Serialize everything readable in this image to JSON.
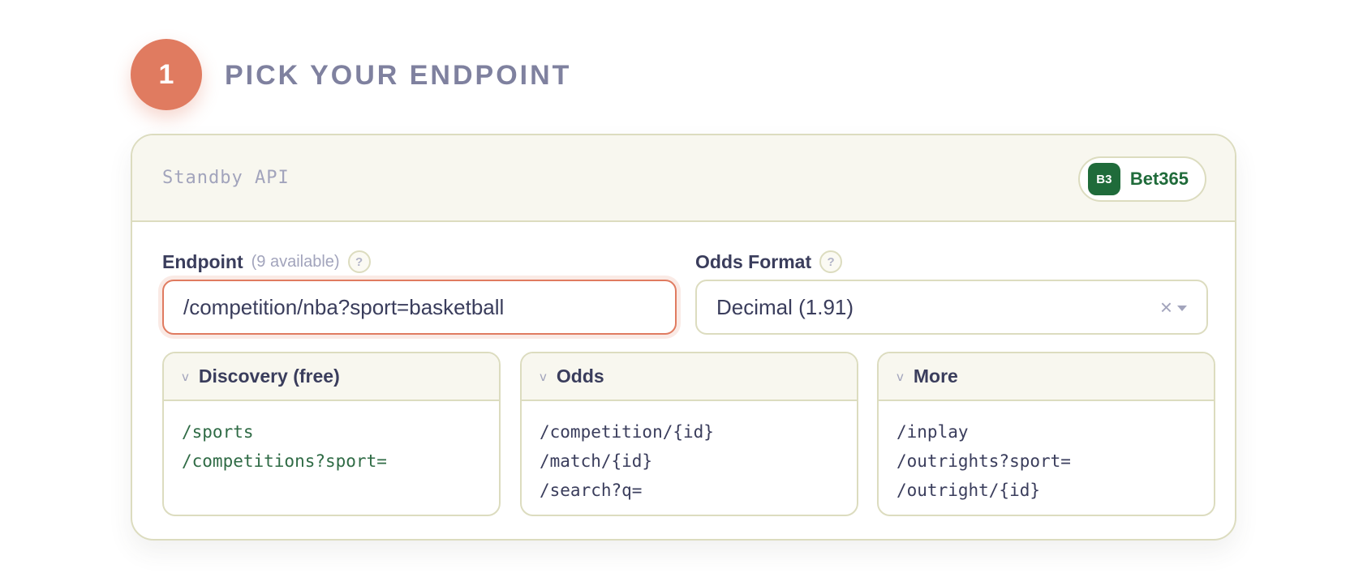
{
  "step": {
    "number": "1",
    "title": "PICK YOUR ENDPOINT"
  },
  "card": {
    "header_title": "Standby API",
    "provider": {
      "logo_text": "B3",
      "name": "Bet365",
      "color": "#1f6b3a"
    }
  },
  "endpoint": {
    "label": "Endpoint",
    "hint": "(9 available)",
    "help": "?",
    "value": "/competition/nba?sport=basketball"
  },
  "odds_format": {
    "label": "Odds Format",
    "help": "?",
    "value": "Decimal (1.91)",
    "clear": "×"
  },
  "groups": [
    {
      "title": "Discovery (free)",
      "chevron": "v",
      "routes": [
        "/sports",
        "/competitions?sport="
      ]
    },
    {
      "title": "Odds",
      "chevron": "v",
      "routes": [
        "/competition/{id}",
        "/match/{id}",
        "/search?q="
      ]
    },
    {
      "title": "More",
      "chevron": "v",
      "routes": [
        "/inplay",
        "/outrights?sport=",
        "/outright/{id}"
      ]
    }
  ],
  "colors": {
    "accent": "#e07b60",
    "border": "#dcdcbf",
    "header_bg": "#f8f7ef",
    "free_route": "#2f6b45"
  }
}
